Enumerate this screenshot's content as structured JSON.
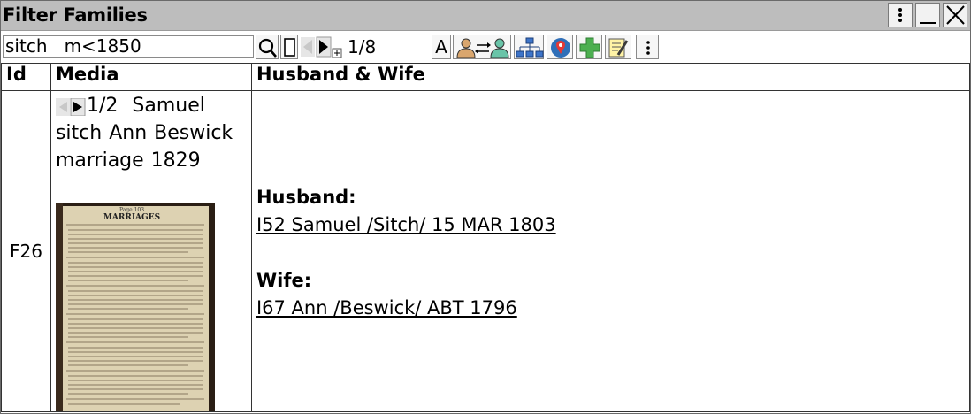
{
  "window": {
    "title": "Filter Families"
  },
  "toolbar": {
    "search_value": "sitch   m<1850",
    "result_counter": "1/8",
    "text_mode_label": "A"
  },
  "table": {
    "headers": {
      "id": "Id",
      "media": "Media",
      "husband_wife": "Husband & Wife"
    },
    "rows": [
      {
        "id": "F26",
        "media": {
          "counter": "1/2",
          "caption": "Samuel sitch Ann Beswick marriage 1829",
          "image_icon": "marriage-register-document"
        },
        "husband_label": "Husband:",
        "husband": "I52 Samuel /Sitch/ 15 MAR 1803",
        "wife_label": "Wife:",
        "wife": "I67 Ann /Beswick/ ABT 1796"
      }
    ]
  },
  "icons": [
    "menu-dots-icon",
    "minimize-icon",
    "close-icon",
    "search-icon",
    "rectangle-icon",
    "prev-arrow-icon",
    "next-arrow-icon",
    "swap-spouses-icon",
    "family-tree-icon",
    "map-pin-icon",
    "add-icon",
    "edit-note-icon"
  ],
  "colors": {
    "titlebar": "#bdbdbd",
    "accent_green": "#4caf50",
    "border": "#333333"
  }
}
